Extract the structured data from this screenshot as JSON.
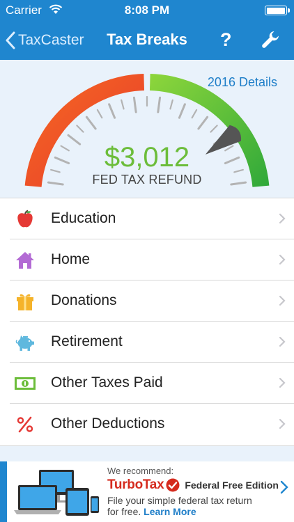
{
  "status_bar": {
    "carrier": "Carrier",
    "time": "8:08 PM"
  },
  "nav": {
    "back_label": "TaxCaster",
    "title": "Tax Breaks",
    "help_label": "?"
  },
  "gauge": {
    "details_link": "2016 Details",
    "amount": "$3,012",
    "label": "FED TAX REFUND",
    "needle_fraction": 0.82,
    "colors": {
      "refund": "#6cbd3a",
      "owe": "#e8402a",
      "bg": "#e9f2fb"
    }
  },
  "categories": [
    {
      "label": "Education",
      "icon": "apple-icon"
    },
    {
      "label": "Home",
      "icon": "house-icon"
    },
    {
      "label": "Donations",
      "icon": "gift-icon"
    },
    {
      "label": "Retirement",
      "icon": "piggy-bank-icon"
    },
    {
      "label": "Other Taxes Paid",
      "icon": "money-icon"
    },
    {
      "label": "Other Deductions",
      "icon": "percent-icon"
    }
  ],
  "ad": {
    "recommend": "We recommend:",
    "brand": "TurboTax",
    "edition": "Federal Free Edition",
    "line1": "File your simple federal tax return",
    "line2_prefix": "for free. ",
    "learn_more": "Learn More",
    "accent_color": "#1f86cf",
    "brand_color": "#d52b1e"
  }
}
